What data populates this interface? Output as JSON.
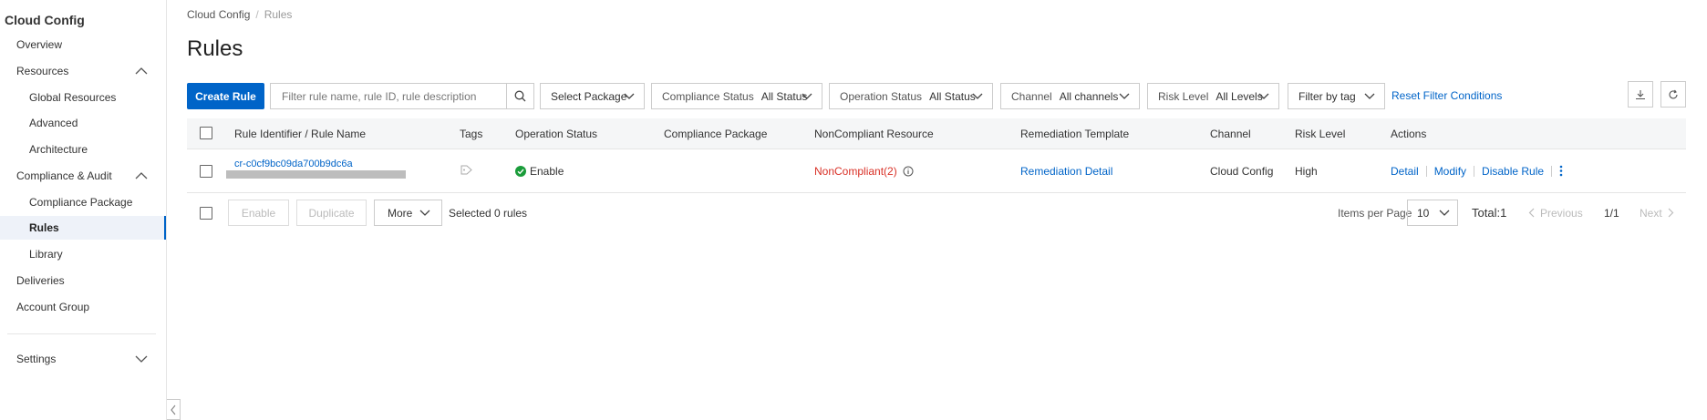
{
  "sidebar": {
    "title": "Cloud Config",
    "items": [
      {
        "label": "Overview"
      },
      {
        "label": "Resources"
      },
      {
        "label": "Global Resources"
      },
      {
        "label": "Advanced"
      },
      {
        "label": "Architecture"
      },
      {
        "label": "Compliance & Audit"
      },
      {
        "label": "Compliance Package"
      },
      {
        "label": "Rules"
      },
      {
        "label": "Library"
      },
      {
        "label": "Deliveries"
      },
      {
        "label": "Account Group"
      },
      {
        "label": "Settings"
      }
    ]
  },
  "breadcrumb": {
    "root": "Cloud Config",
    "sep": "/",
    "current": "Rules"
  },
  "page_title": "Rules",
  "toolbar": {
    "create_label": "Create Rule",
    "search_placeholder": "Filter rule name, rule ID, rule description",
    "select_package": "Select Package",
    "compliance_label": "Compliance Status",
    "compliance_value": "All Status",
    "operation_label": "Operation Status",
    "operation_value": "All Status",
    "channel_label": "Channel",
    "channel_value": "All channels",
    "risk_label": "Risk Level",
    "risk_value": "All Levels",
    "filter_tag": "Filter by tag",
    "reset": "Reset Filter Conditions"
  },
  "table": {
    "headers": [
      "Rule Identifier / Rule Name",
      "Tags",
      "Operation Status",
      "Compliance Package",
      "NonCompliant Resource",
      "Remediation Template",
      "Channel",
      "Risk Level",
      "Actions"
    ],
    "rows": [
      {
        "rule_id": "cr-c0cf9bc09da700b9dc6a",
        "operation_status": "Enable",
        "noncompliant": "NonCompliant(2)",
        "remediation": "Remediation Detail",
        "channel": "Cloud Config",
        "risk": "High",
        "actions": [
          "Detail",
          "Modify",
          "Disable Rule"
        ]
      }
    ]
  },
  "footer": {
    "enable": "Enable",
    "duplicate": "Duplicate",
    "more": "More",
    "selected": "Selected 0 rules",
    "items_per_page_label": "Items per Page",
    "items_per_page": "10",
    "total": "Total:1",
    "previous": "Previous",
    "page": "1/1",
    "next": "Next"
  },
  "colors": {
    "primary": "#0064c8",
    "danger": "#d93026",
    "success": "#1a9c3a"
  }
}
